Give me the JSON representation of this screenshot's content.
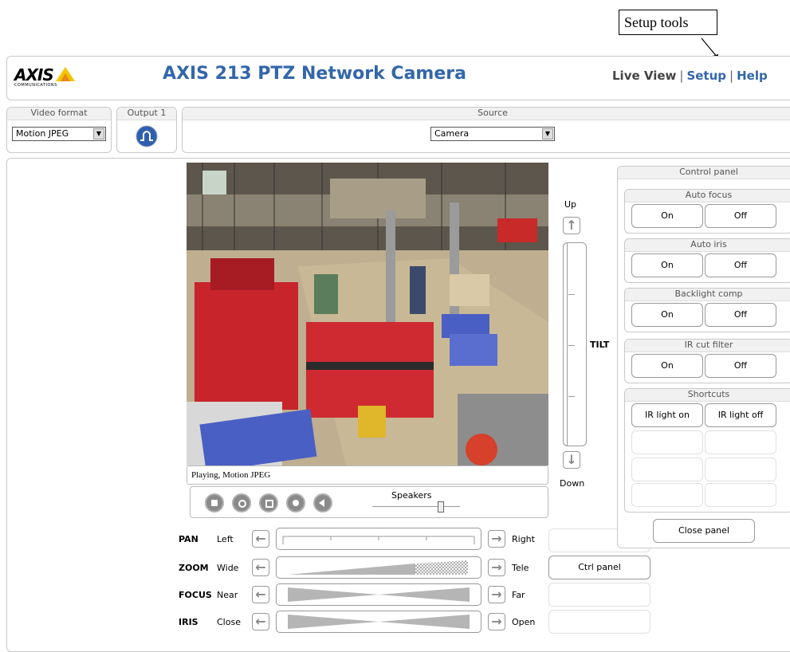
{
  "callout": "Setup tools",
  "header": {
    "logo_text": "AXIS",
    "logo_sub": "COMMUNICATIONS",
    "title": "AXIS 213 PTZ Network Camera",
    "nav": {
      "live_view": "Live View",
      "setup": "Setup",
      "help": "Help",
      "sep": "|"
    }
  },
  "video_format": {
    "label": "Video format",
    "value": "Motion JPEG"
  },
  "output": {
    "label": "Output 1"
  },
  "source": {
    "label": "Source",
    "value": "Camera"
  },
  "status": "Playing, Motion JPEG",
  "speakers": "Speakers",
  "tilt": {
    "up": "Up",
    "down": "Down",
    "label": "TILT"
  },
  "controls": {
    "pan": {
      "label": "PAN",
      "left": "Left",
      "right": "Right"
    },
    "zoom": {
      "label": "ZOOM",
      "left": "Wide",
      "right": "Tele"
    },
    "focus": {
      "label": "FOCUS",
      "left": "Near",
      "right": "Far"
    },
    "iris": {
      "label": "IRIS",
      "left": "Close",
      "right": "Open"
    }
  },
  "ctrl_panel_button": "Ctrl panel",
  "panel": {
    "title": "Control panel",
    "groups": [
      {
        "title": "Auto focus",
        "on": "On",
        "off": "Off"
      },
      {
        "title": "Auto iris",
        "on": "On",
        "off": "Off"
      },
      {
        "title": "Backlight comp",
        "on": "On",
        "off": "Off"
      },
      {
        "title": "IR cut filter",
        "on": "On",
        "off": "Off"
      }
    ],
    "shortcuts": {
      "title": "Shortcuts",
      "ir_on": "IR light on",
      "ir_off": "IR light off"
    },
    "close": "Close panel"
  },
  "colors": {
    "accent": "#3366aa",
    "border": "#c8c8c8",
    "machine_red": "#c8242c",
    "pallet_blue": "#4a5fc4"
  },
  "icons": [
    "output-icon",
    "stop-icon",
    "snapshot-icon",
    "view-icon",
    "ptz-icon",
    "speaker-icon",
    "arrow-up-icon",
    "arrow-down-icon",
    "arrow-left-icon",
    "arrow-right-icon",
    "dropdown-icon"
  ]
}
